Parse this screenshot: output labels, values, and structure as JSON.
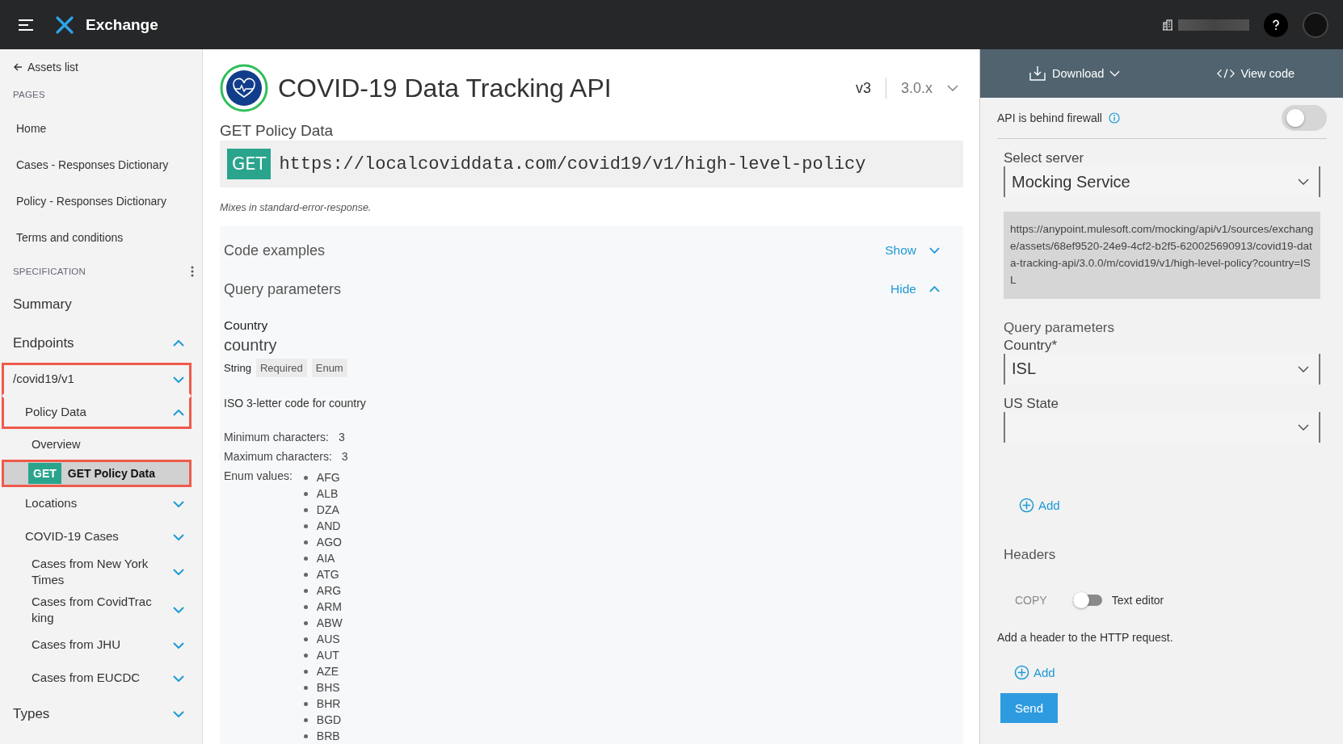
{
  "top_bar": {
    "app_name": "Exchange"
  },
  "sidebar": {
    "back_link": "Assets list",
    "pages_heading": "PAGES",
    "pages": [
      "Home",
      "Cases - Responses Dictionary",
      "Policy - Responses Dictionary",
      "Terms and conditions"
    ],
    "spec_heading": "SPECIFICATION",
    "nav": [
      {
        "kind": "section",
        "label": "Summary",
        "highlighted": false
      },
      {
        "kind": "section",
        "label": "Endpoints",
        "expanded": true,
        "highlighted": false,
        "children": [
          {
            "kind": "resource",
            "label": "/covid19/v1",
            "expanded": false,
            "highlighted": true,
            "children": [
              {
                "kind": "resource",
                "label": "Policy Data",
                "expanded": true,
                "highlighted": true,
                "children": [
                  {
                    "kind": "page",
                    "label": "Overview",
                    "selected": false,
                    "highlighted": false
                  },
                  {
                    "kind": "method",
                    "method": "GET",
                    "label": "GET Policy Data",
                    "selected": true,
                    "highlighted": true
                  }
                ]
              },
              {
                "kind": "resource",
                "label": "Locations",
                "expanded": false,
                "highlighted": false
              },
              {
                "kind": "resource",
                "label": "COVID-19 Cases",
                "expanded": false,
                "highlighted": false,
                "children": [
                  {
                    "kind": "resource",
                    "label": "Cases from New York Times",
                    "expanded": false,
                    "highlighted": false
                  },
                  {
                    "kind": "resource",
                    "label": "Cases from CovidTracking",
                    "expanded": false,
                    "highlighted": false
                  },
                  {
                    "kind": "resource",
                    "label": "Cases from JHU",
                    "expanded": false,
                    "highlighted": false
                  },
                  {
                    "kind": "resource",
                    "label": "Cases from EUCDC",
                    "expanded": false,
                    "highlighted": false
                  }
                ]
              }
            ]
          }
        ]
      },
      {
        "kind": "section",
        "label": "Types",
        "expanded": false,
        "highlighted": false
      }
    ]
  },
  "main": {
    "title": "COVID-19 Data Tracking API",
    "version": "v3",
    "release": "3.0.x",
    "method_title": "GET Policy Data",
    "method": "GET",
    "url": "https://localcoviddata.com/covid19/v1/high-level-policy",
    "mixes_note": "Mixes in standard-error-response.",
    "sections": [
      {
        "title": "Code examples",
        "toggle_label": "Show",
        "expanded": false
      },
      {
        "title": "Query parameters",
        "toggle_label": "Hide",
        "expanded": true
      }
    ],
    "parameter": {
      "display_name": "Country",
      "name": "country",
      "type": "String",
      "tags": [
        "Required",
        "Enum"
      ],
      "description": "ISO 3-letter code for country",
      "min_label": "Minimum characters:",
      "min_value": "3",
      "max_label": "Maximum characters:",
      "max_value": "3",
      "enum_label": "Enum values:",
      "enum_values": [
        "AFG",
        "ALB",
        "DZA",
        "AND",
        "AGO",
        "AIA",
        "ATG",
        "ARG",
        "ARM",
        "ABW",
        "AUS",
        "AUT",
        "AZE",
        "BHS",
        "BHR",
        "BGD",
        "BRB"
      ]
    }
  },
  "console": {
    "download_label": "Download",
    "view_code_label": "View code",
    "firewall_label": "API is behind firewall",
    "firewall_on": false,
    "server_label": "Select server",
    "server_value": "Mocking Service",
    "request_url": "https://anypoint.mulesoft.com/mocking/api/v1/sources/exchange/assets/68ef9520-24e9-4cf2-b2f5-620025690913/covid19-data-tracking-api/3.0.0/m/covid19/v1/high-level-policy?country=ISL",
    "query_heading": "Query parameters",
    "query_fields": [
      {
        "label": "Country*",
        "value": "ISL"
      },
      {
        "label": "US State"
      }
    ],
    "add_label": "Add",
    "headers_heading": "Headers",
    "copy_label": "COPY",
    "text_editor_label": "Text editor",
    "text_editor_on": false,
    "headers_hint": "Add a header to the HTTP request.",
    "add_header_label": "Add",
    "send_label": "Send"
  }
}
